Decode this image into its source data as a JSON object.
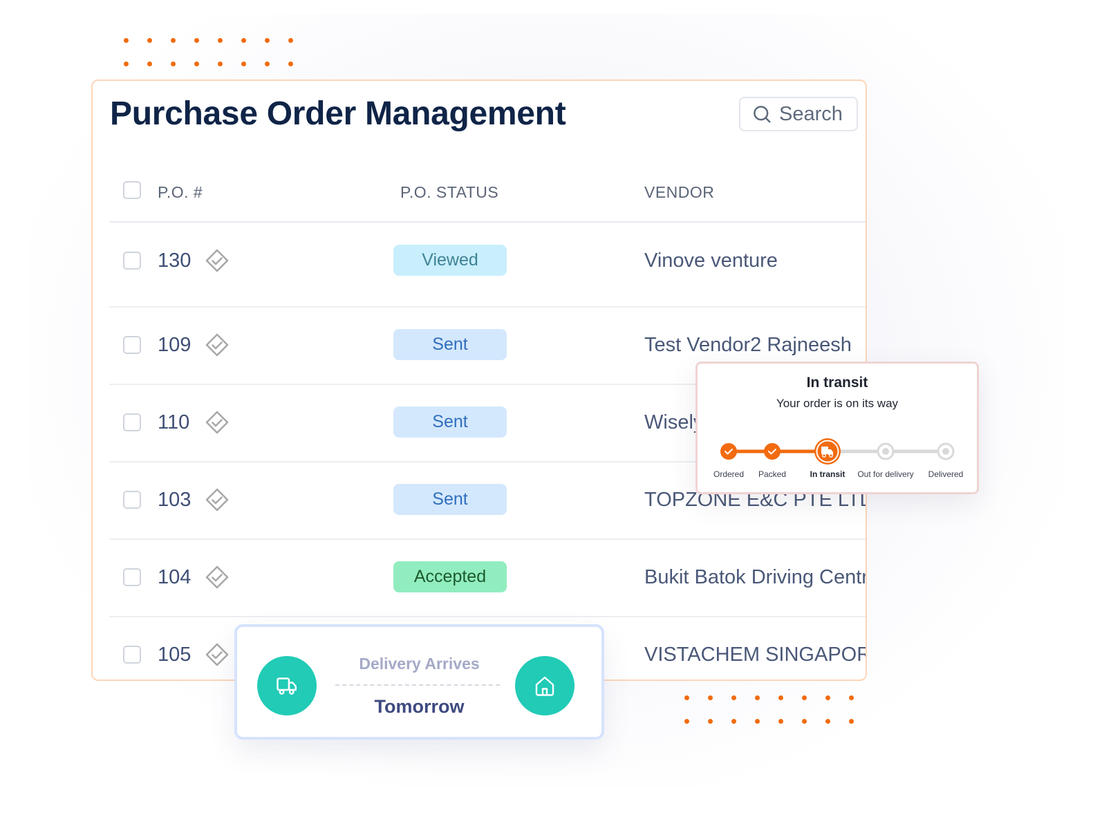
{
  "colors": {
    "accent_orange": "#f26b0f",
    "teal": "#21cbb6",
    "title_navy": "#0f2447"
  },
  "header": {
    "title": "Purchase Order Management",
    "search": {
      "label": "Search",
      "icon": "search-icon"
    }
  },
  "table": {
    "columns": [
      "P.O. #",
      "P.O. STATUS",
      "VENDOR"
    ],
    "rows": [
      {
        "po": "130",
        "status": "Viewed",
        "status_bg": "#c9effc",
        "status_fg": "#3f8195",
        "vendor": "Vinove venture"
      },
      {
        "po": "109",
        "status": "Sent",
        "status_bg": "#d4e8fd",
        "status_fg": "#2f6fbd",
        "vendor": "Test Vendor2 Rajneesh"
      },
      {
        "po": "110",
        "status": "Sent",
        "status_bg": "#d4e8fd",
        "status_fg": "#2f6fbd",
        "vendor": "Wisely"
      },
      {
        "po": "103",
        "status": "Sent",
        "status_bg": "#d4e8fd",
        "status_fg": "#2f6fbd",
        "vendor": "TOPZONE E&C PTE LTD"
      },
      {
        "po": "104",
        "status": "Accepted",
        "status_bg": "#91edbf",
        "status_fg": "#1d5a2e",
        "vendor": "Bukit Batok Driving Centre"
      },
      {
        "po": "105",
        "status": "",
        "status_bg": "",
        "status_fg": "",
        "vendor": "VISTACHEM SINGAPORE"
      }
    ]
  },
  "transit_card": {
    "title": "In transit",
    "subtitle": "Your order is on its way",
    "current_step": 2,
    "steps": [
      {
        "label": "Ordered",
        "state": "done"
      },
      {
        "label": "Packed",
        "state": "done"
      },
      {
        "label": "In transit",
        "state": "current"
      },
      {
        "label": "Out for delivery",
        "state": "pending"
      },
      {
        "label": "Delivered",
        "state": "pending"
      }
    ]
  },
  "delivery_card": {
    "label": "Delivery Arrives",
    "value": "Tomorrow",
    "left_icon": "truck-icon",
    "right_icon": "home-icon"
  }
}
